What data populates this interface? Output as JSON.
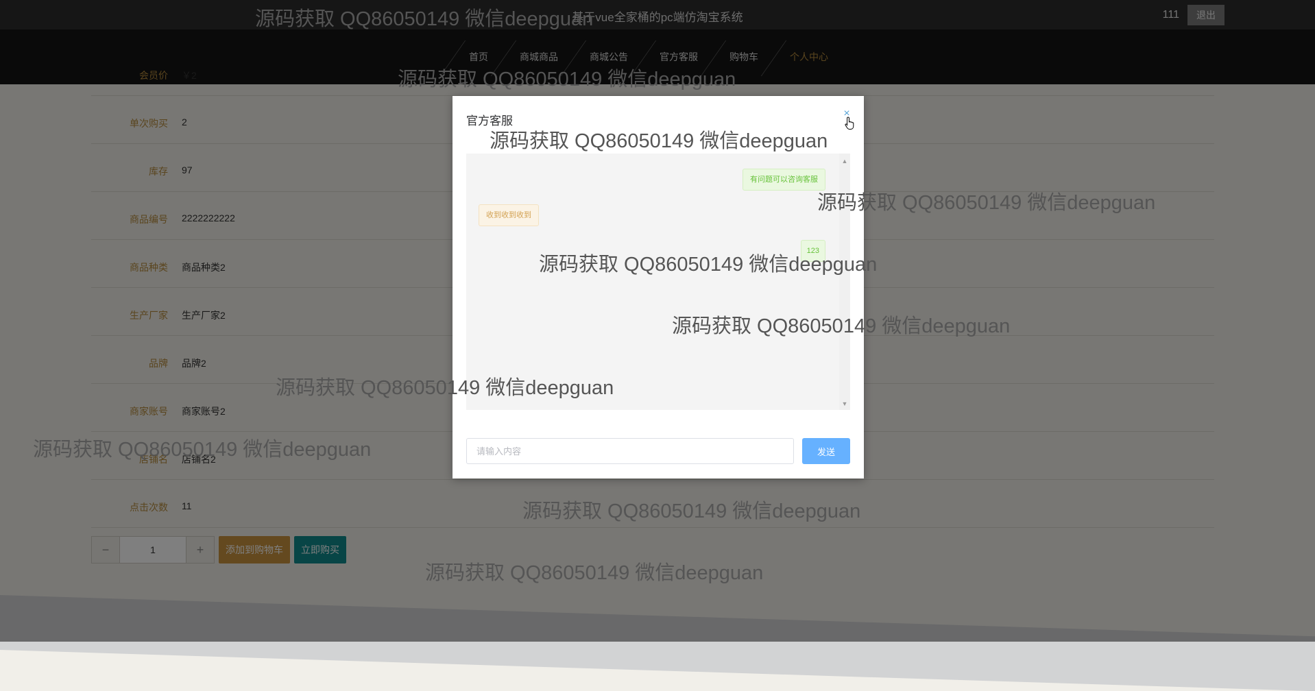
{
  "header": {
    "site_title": "基于vue全家桶的pc端仿淘宝系统",
    "username": "111",
    "logout_label": "退出"
  },
  "nav": {
    "items": [
      {
        "label": "首页"
      },
      {
        "label": "商城商品"
      },
      {
        "label": "商城公告"
      },
      {
        "label": "官方客服"
      },
      {
        "label": "购物车"
      },
      {
        "label": "个人中心"
      }
    ],
    "active_index": 5
  },
  "product_detail": {
    "rows": [
      {
        "label": "会员价",
        "value": "￥2"
      },
      {
        "label": "单次购买",
        "value": "2"
      },
      {
        "label": "库存",
        "value": "97"
      },
      {
        "label": "商品编号",
        "value": "2222222222"
      },
      {
        "label": "商品种类",
        "value": "商品种类2"
      },
      {
        "label": "生产厂家",
        "value": "生产厂家2"
      },
      {
        "label": "品牌",
        "value": "品牌2"
      },
      {
        "label": "商家账号",
        "value": "商家账号2"
      },
      {
        "label": "店铺名",
        "value": "店铺名2"
      },
      {
        "label": "点击次数",
        "value": "11"
      }
    ],
    "quantity": "1",
    "minus_label": "−",
    "plus_label": "+",
    "add_to_cart_label": "添加到购物车",
    "buy_now_label": "立即购买"
  },
  "dialog": {
    "title": "官方客服",
    "close_icon": "×",
    "messages": [
      {
        "side": "right",
        "text": "有问题可以咨询客服"
      },
      {
        "side": "left",
        "text": "收到收到收到"
      },
      {
        "side": "right",
        "text": "123"
      }
    ],
    "input_placeholder": "请输入内容",
    "send_label": "发送"
  },
  "watermark": {
    "text": "源码获取 QQ86050149 微信deepguan"
  },
  "colors": {
    "accent_gold": "#b58a3c",
    "buy_teal": "#118a8c",
    "send_blue": "#66b1ff",
    "bubble_green": "#67c23a",
    "bubble_orange": "#d3a253"
  }
}
